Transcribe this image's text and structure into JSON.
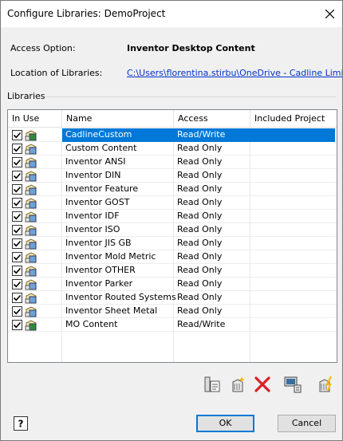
{
  "window": {
    "title": "Configure Libraries: DemoProject"
  },
  "access_option": {
    "label": "Access Option:",
    "value": "Inventor Desktop Content"
  },
  "location": {
    "label": "Location of Libraries:",
    "value": "C:\\Users\\florentina.stirbu\\OneDrive - Cadline Limited\\"
  },
  "libraries": {
    "group_label": "Libraries",
    "columns": [
      "In Use",
      "Name",
      "Access",
      "Included Project"
    ],
    "rows": [
      {
        "name": "CadlineCustom",
        "access": "Read/Write",
        "included": "",
        "in_use": true,
        "selected": true,
        "icon": "library-rw-icon"
      },
      {
        "name": "Custom Content",
        "access": "Read Only",
        "included": "",
        "in_use": true,
        "selected": false,
        "icon": "library-icon"
      },
      {
        "name": "Inventor ANSI",
        "access": "Read Only",
        "included": "",
        "in_use": true,
        "selected": false,
        "icon": "library-icon"
      },
      {
        "name": "Inventor DIN",
        "access": "Read Only",
        "included": "",
        "in_use": true,
        "selected": false,
        "icon": "library-icon"
      },
      {
        "name": "Inventor Feature",
        "access": "Read Only",
        "included": "",
        "in_use": true,
        "selected": false,
        "icon": "library-icon"
      },
      {
        "name": "Inventor GOST",
        "access": "Read Only",
        "included": "",
        "in_use": true,
        "selected": false,
        "icon": "library-icon"
      },
      {
        "name": "Inventor IDF",
        "access": "Read Only",
        "included": "",
        "in_use": true,
        "selected": false,
        "icon": "library-icon"
      },
      {
        "name": "Inventor ISO",
        "access": "Read Only",
        "included": "",
        "in_use": true,
        "selected": false,
        "icon": "library-icon"
      },
      {
        "name": "Inventor JIS GB",
        "access": "Read Only",
        "included": "",
        "in_use": true,
        "selected": false,
        "icon": "library-icon"
      },
      {
        "name": "Inventor Mold Metric",
        "access": "Read Only",
        "included": "",
        "in_use": true,
        "selected": false,
        "icon": "library-icon"
      },
      {
        "name": "Inventor OTHER",
        "access": "Read Only",
        "included": "",
        "in_use": true,
        "selected": false,
        "icon": "library-icon"
      },
      {
        "name": "Inventor Parker",
        "access": "Read Only",
        "included": "",
        "in_use": true,
        "selected": false,
        "icon": "library-icon"
      },
      {
        "name": "Inventor Routed Systems",
        "access": "Read Only",
        "included": "",
        "in_use": true,
        "selected": false,
        "icon": "library-icon"
      },
      {
        "name": "Inventor Sheet Metal",
        "access": "Read Only",
        "included": "",
        "in_use": true,
        "selected": false,
        "icon": "library-icon"
      },
      {
        "name": "MO Content",
        "access": "Read/Write",
        "included": "",
        "in_use": true,
        "selected": false,
        "icon": "library-rw-icon"
      }
    ]
  },
  "toolbar": {
    "icons": [
      "library-properties-icon",
      "create-library-icon",
      "delete-library-icon",
      "library-options-icon",
      "update-library-icon"
    ]
  },
  "buttons": {
    "ok": "OK",
    "cancel": "Cancel",
    "help_icon": "help-icon"
  },
  "colors": {
    "selection": "#0078d7",
    "link": "#0033cc",
    "delete_red": "#d9202a",
    "primary_border": "#0078d7"
  }
}
